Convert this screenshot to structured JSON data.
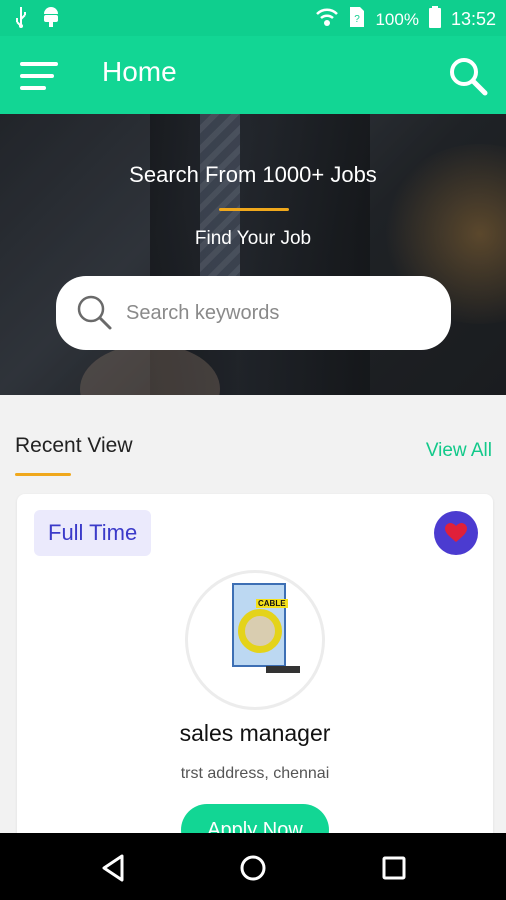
{
  "status_bar": {
    "battery": "100%",
    "time": "13:52",
    "icons": [
      "usb-icon",
      "android-icon",
      "wifi-icon",
      "sim-icon",
      "battery-icon"
    ]
  },
  "app_bar": {
    "title": "Home",
    "menu_icon": "hamburger-menu-icon",
    "search_icon": "search-icon"
  },
  "hero": {
    "headline": "Search From 1000+ Jobs",
    "subheadline": "Find Your Job",
    "search_placeholder": "Search keywords",
    "search_value": ""
  },
  "recent": {
    "title": "Recent View",
    "view_all": "View All"
  },
  "job_card": {
    "badge": "Full Time",
    "favorite": true,
    "company_logo_text": "CABLE",
    "title": "sales manager",
    "address": "trst address, chennai",
    "apply_label": "Apply Now"
  },
  "nav_bar": {
    "icons": [
      "back-icon",
      "home-icon",
      "recents-icon"
    ]
  },
  "colors": {
    "primary": "#12d694",
    "accent": "#f0a81c",
    "badge_text": "#3b3ac9",
    "badge_bg": "#ebeafc",
    "favorite_bg": "#4b3bd0",
    "heart": "#e0203a"
  }
}
